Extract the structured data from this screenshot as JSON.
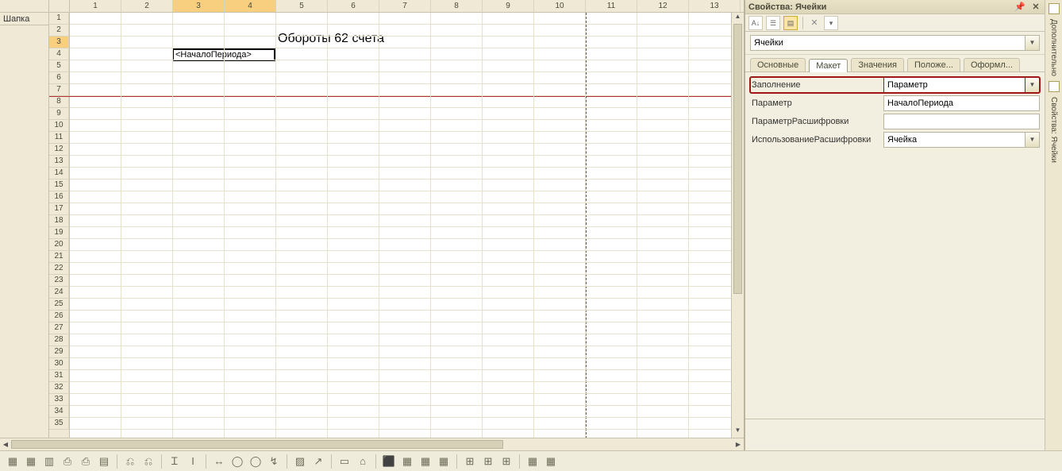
{
  "grid": {
    "rowgroup_labels": [
      "Шапка"
    ],
    "col_headers": [
      "1",
      "2",
      "3",
      "4",
      "5",
      "6",
      "7",
      "8",
      "9",
      "10",
      "11",
      "12",
      "13"
    ],
    "row_headers": [
      "1",
      "2",
      "3",
      "4",
      "5",
      "6",
      "7",
      "8",
      "9",
      "10",
      "11",
      "12",
      "13",
      "14",
      "15",
      "16",
      "17",
      "18",
      "19",
      "20",
      "21",
      "22",
      "23",
      "24",
      "25",
      "26",
      "27",
      "28",
      "29",
      "30",
      "31",
      "32",
      "33",
      "34",
      "35"
    ],
    "selected_cols": [
      "3",
      "4"
    ],
    "selected_rows": [
      "3"
    ],
    "title_cell": "Обороты 62 счета",
    "selected_cell_text": "<НачалоПериода>"
  },
  "props": {
    "panel_title": "Свойства: Ячейки",
    "type_value": "Ячейки",
    "tabs": [
      "Основные",
      "Макет",
      "Значения",
      "Положе...",
      "Оформл..."
    ],
    "active_tab": "Макет",
    "rows": {
      "fill": {
        "label": "Заполнение",
        "value": "Параметр"
      },
      "param": {
        "label": "Параметр",
        "value": "НачалоПериода"
      },
      "dparam": {
        "label": "ПараметрРасшифровки",
        "value": ""
      },
      "duse": {
        "label": "ИспользованиеРасшифровки",
        "value": "Ячейка"
      }
    }
  },
  "siderail": {
    "labels": [
      "Дополнительно",
      "Свойства: Ячейки"
    ]
  },
  "bottom_icons": [
    "▦",
    "▦",
    "▥",
    "⎙",
    "⎙",
    "▤",
    "⎌",
    "⎌",
    "Ꮖ",
    "I",
    "↔",
    "◯",
    "◯",
    "↯",
    "▨",
    "↗",
    "▭",
    "⌂",
    "⬛",
    "▦",
    "▦",
    "▦",
    "⊞",
    "⊞",
    "⊞",
    "▦",
    "▦"
  ]
}
